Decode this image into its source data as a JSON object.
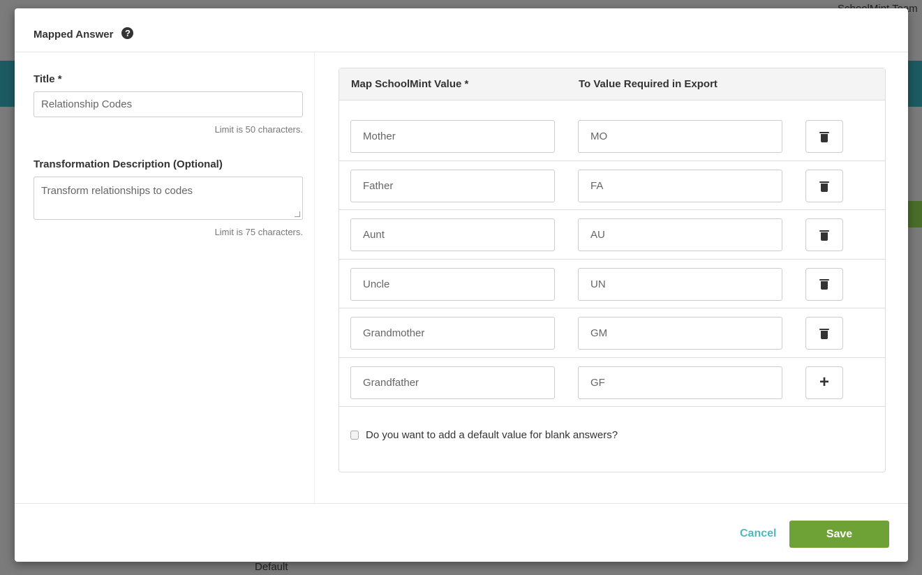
{
  "background": {
    "team_label": "SchoolMint Team",
    "default_label": "Default"
  },
  "modal": {
    "title": "Mapped Answer",
    "help_icon": "question-circle-icon",
    "title_field": {
      "label": "Title *",
      "value": "Relationship Codes",
      "hint": "Limit is 50 characters."
    },
    "description_field": {
      "label": "Transformation Description (Optional)",
      "value": "Transform relationships to codes",
      "hint": "Limit is 75 characters."
    },
    "mapping": {
      "col1": "Map SchoolMint Value *",
      "col2": "To Value Required in Export",
      "rows": [
        {
          "from": "Mother",
          "to": "MO",
          "action": "delete"
        },
        {
          "from": "Father",
          "to": "FA",
          "action": "delete"
        },
        {
          "from": "Aunt",
          "to": "AU",
          "action": "delete"
        },
        {
          "from": "Uncle",
          "to": "UN",
          "action": "delete"
        },
        {
          "from": "Grandmother",
          "to": "GM",
          "action": "delete"
        },
        {
          "from": "Grandfather",
          "to": "GF",
          "action": "add"
        }
      ],
      "default_checkbox": {
        "label": "Do you want to add a default value for blank answers?",
        "checked": false
      }
    },
    "cancel_label": "Cancel",
    "save_label": "Save",
    "colors": {
      "save": "#6ea136",
      "cancel": "#4fb8c0"
    }
  }
}
